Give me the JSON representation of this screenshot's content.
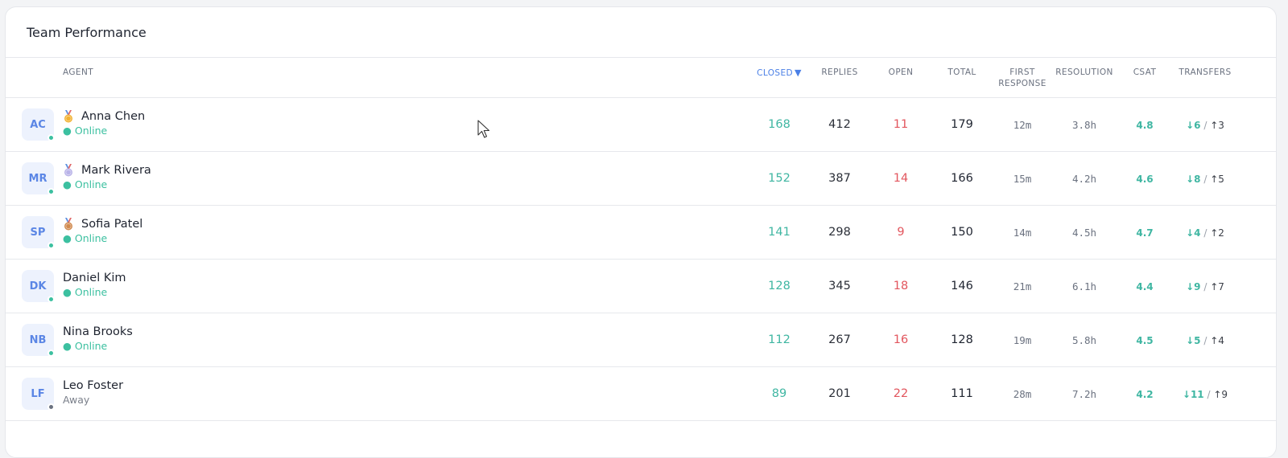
{
  "panel": {
    "title": "Team Performance"
  },
  "columns": {
    "agent": "AGENT",
    "closed": "CLOSED",
    "replies": "REPLIES",
    "open": "OPEN",
    "total": "TOTAL",
    "first_response_l1": "FIRST",
    "first_response_l2": "RESPONSE",
    "resolution": "RESOLUTION",
    "csat": "CSAT",
    "transfers": "TRANSFERS"
  },
  "sort": {
    "column": "closed",
    "direction": "desc",
    "icon": "caret-down-icon"
  },
  "colors": {
    "online": "#3cc0a0",
    "away": "#6b7280",
    "gold": "#f2b233",
    "silver": "#b9b3e8",
    "bronze": "#d08a4f"
  },
  "rows": [
    {
      "initials": "AC",
      "medal": "gold",
      "name": "Anna Chen",
      "status": "● Online",
      "online": true,
      "closed": "168",
      "replies": "412",
      "open": "11",
      "total": "179",
      "first_response": "12m",
      "resolution": "3.8h",
      "csat": "4.8",
      "transfers_in": "↓6",
      "transfers_out": "↑3"
    },
    {
      "initials": "MR",
      "medal": "silver",
      "name": "Mark Rivera",
      "status": "● Online",
      "online": true,
      "closed": "152",
      "replies": "387",
      "open": "14",
      "total": "166",
      "first_response": "15m",
      "resolution": "4.2h",
      "csat": "4.6",
      "transfers_in": "↓8",
      "transfers_out": "↑5"
    },
    {
      "initials": "SP",
      "medal": "bronze",
      "name": "Sofia Patel",
      "status": "● Online",
      "online": true,
      "closed": "141",
      "replies": "298",
      "open": "9",
      "total": "150",
      "first_response": "14m",
      "resolution": "4.5h",
      "csat": "4.7",
      "transfers_in": "↓4",
      "transfers_out": "↑2"
    },
    {
      "initials": "DK",
      "medal": "",
      "name": "Daniel Kim",
      "status": "● Online",
      "online": true,
      "closed": "128",
      "replies": "345",
      "open": "18",
      "total": "146",
      "first_response": "21m",
      "resolution": "6.1h",
      "csat": "4.4",
      "transfers_in": "↓9",
      "transfers_out": "↑7"
    },
    {
      "initials": "NB",
      "medal": "",
      "name": "Nina Brooks",
      "status": "● Online",
      "online": true,
      "closed": "112",
      "replies": "267",
      "open": "16",
      "total": "128",
      "first_response": "19m",
      "resolution": "5.8h",
      "csat": "4.5",
      "transfers_in": "↓5",
      "transfers_out": "↑4"
    },
    {
      "initials": "LF",
      "medal": "",
      "name": "Leo Foster",
      "status": "Away",
      "online": false,
      "closed": "89",
      "replies": "201",
      "open": "22",
      "total": "111",
      "first_response": "28m",
      "resolution": "7.2h",
      "csat": "4.2",
      "transfers_in": "↓11",
      "transfers_out": "↑9"
    }
  ],
  "transfer_separator": "/"
}
